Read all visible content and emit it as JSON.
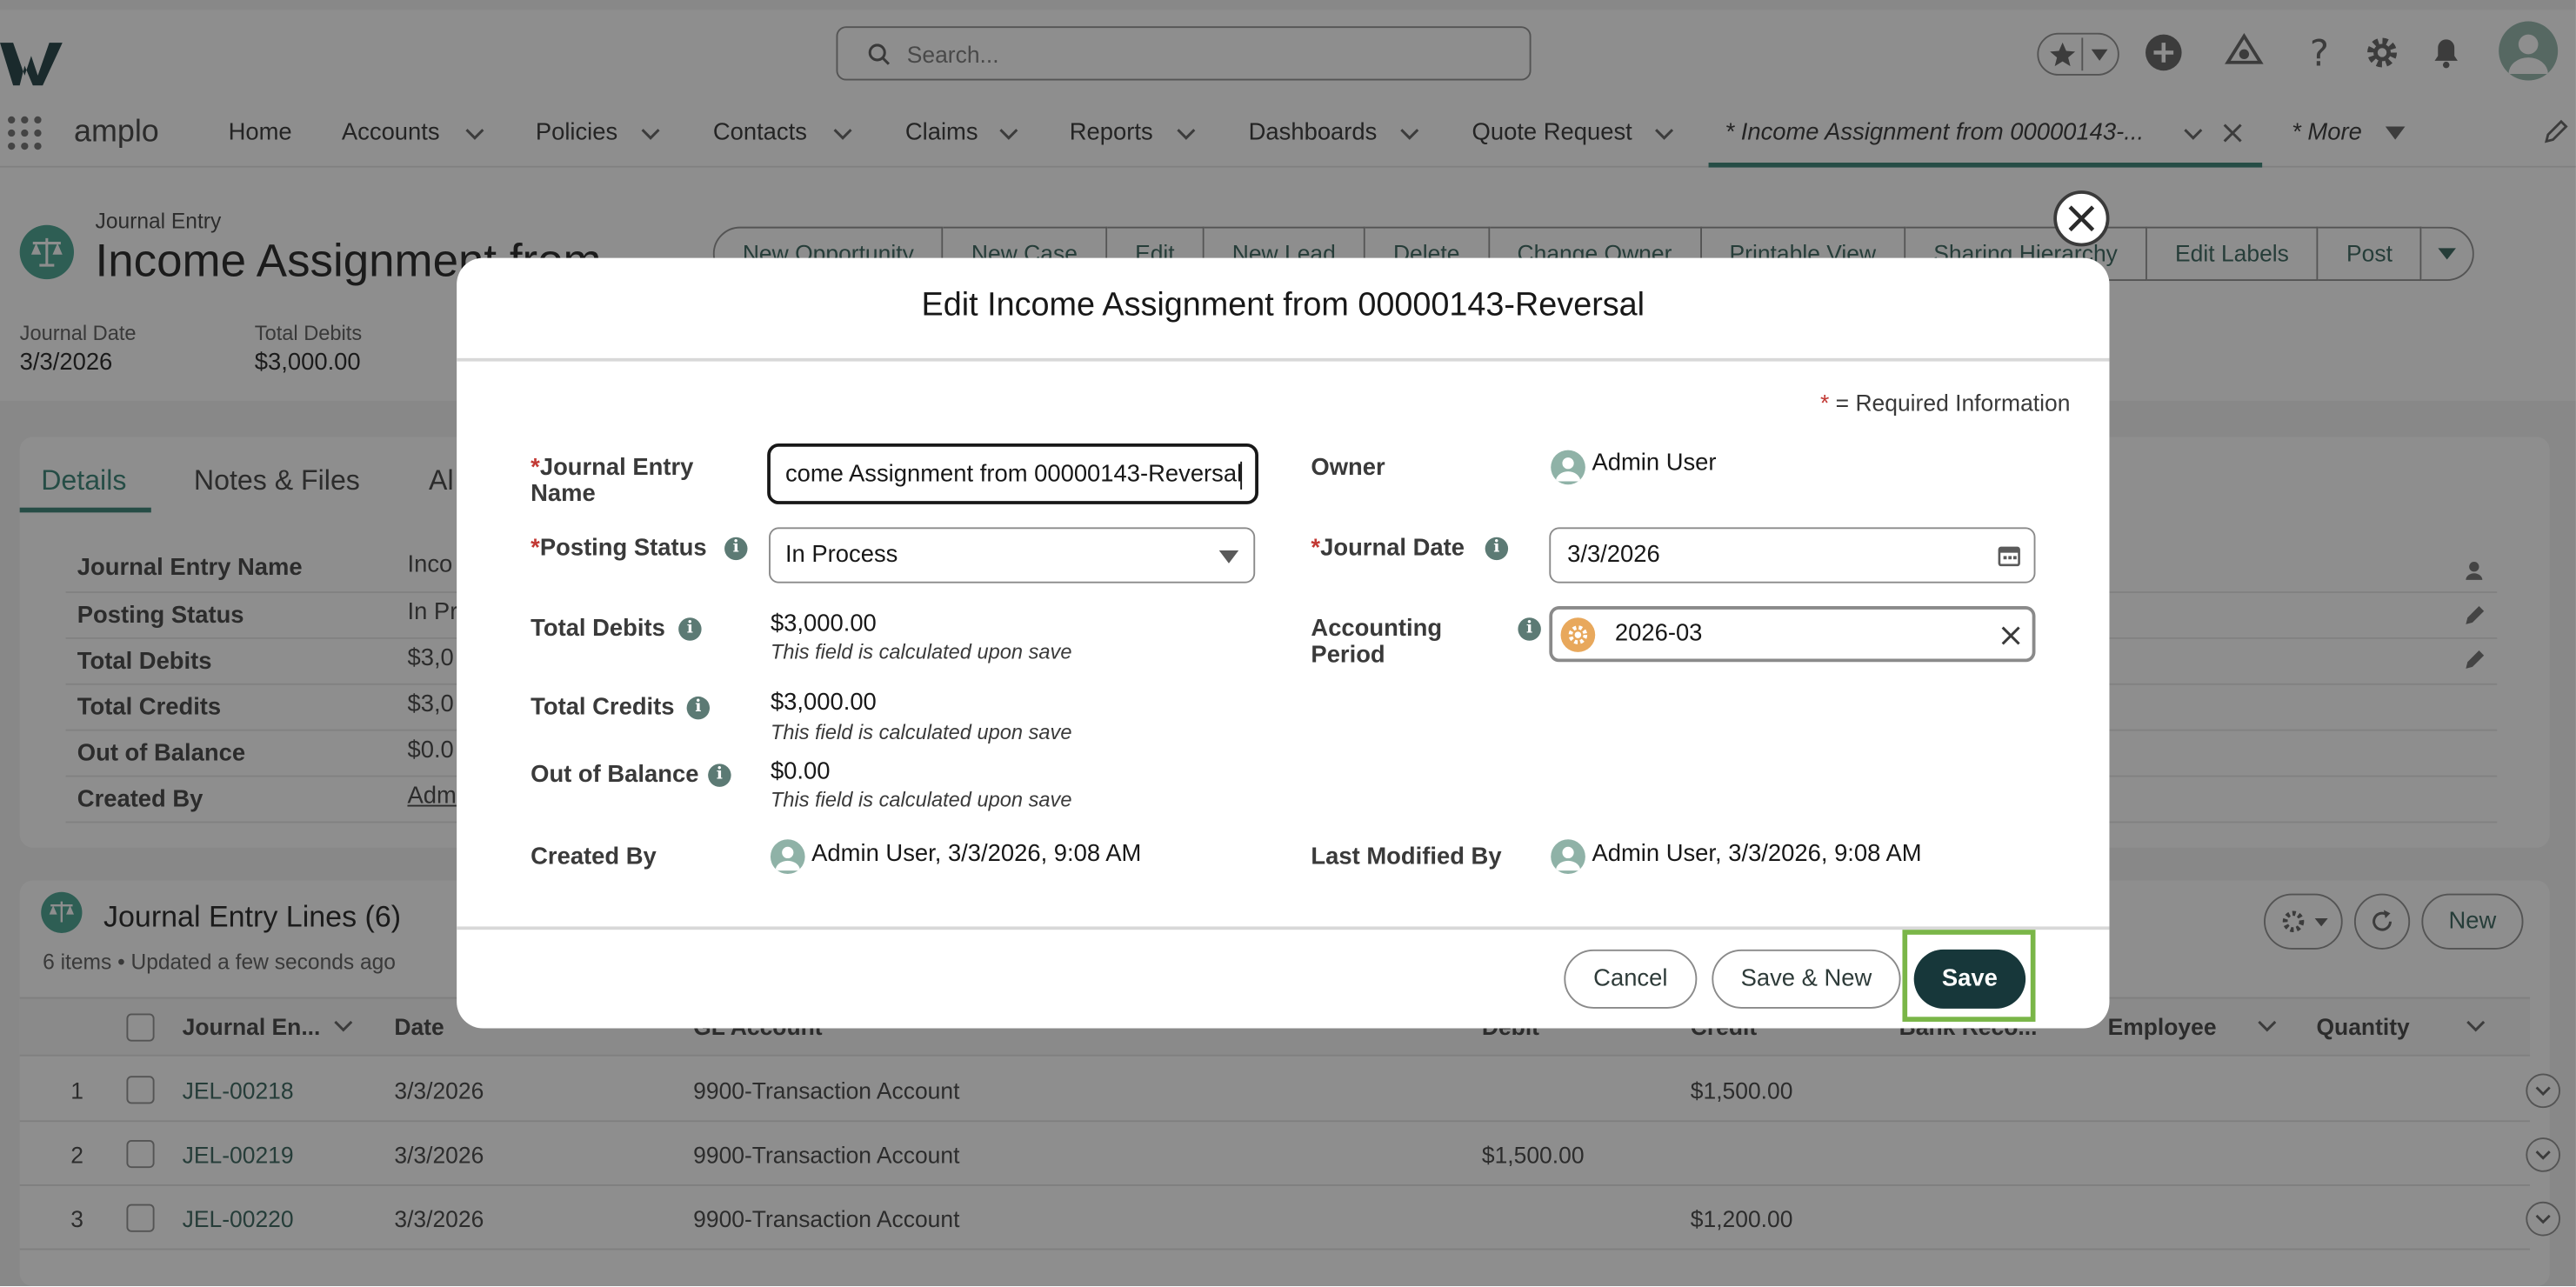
{
  "header": {
    "search_placeholder": "Search...",
    "app_name": "amplo"
  },
  "nav": {
    "items": [
      "Home",
      "Accounts",
      "Policies",
      "Contacts",
      "Claims",
      "Reports",
      "Dashboards",
      "Quote Request"
    ],
    "active_tab": "* Income Assignment from 00000143-...",
    "more": "* More"
  },
  "record": {
    "object_label": "Journal Entry",
    "title": "Income Assignment from",
    "actions": [
      "New Opportunity",
      "New Case",
      "Edit",
      "New Lead",
      "Delete",
      "Change Owner",
      "Printable View",
      "Sharing Hierarchy",
      "Edit Labels",
      "Post"
    ],
    "highlights": [
      {
        "label": "Journal Date",
        "value": "3/3/2026"
      },
      {
        "label": "Total Debits",
        "value": "$3,000.00"
      }
    ]
  },
  "detail_tabs": [
    "Details",
    "Notes & Files",
    "Al"
  ],
  "details": [
    {
      "label": "Journal Entry Name",
      "value": "Inco"
    },
    {
      "label": "Posting Status",
      "value": "In Pr"
    },
    {
      "label": "Total Debits",
      "value": "$3,0"
    },
    {
      "label": "Total Credits",
      "value": "$3,0"
    },
    {
      "label": "Out of Balance",
      "value": "$0.0"
    },
    {
      "label": "Created By",
      "value": "Adm"
    }
  ],
  "lines": {
    "title": "Journal Entry Lines (6)",
    "subtitle": "6 items • Updated a few seconds ago",
    "new_button": "New",
    "columns": [
      "Journal En...",
      "Date",
      "GL Account",
      "Debit",
      "Credit",
      "Bank Reco...",
      "Employee",
      "Quantity"
    ],
    "rows": [
      {
        "num": "1",
        "name": "JEL-00218",
        "date": "3/3/2026",
        "gl": "9900-Transaction Account",
        "debit": "",
        "credit": "$1,500.00"
      },
      {
        "num": "2",
        "name": "JEL-00219",
        "date": "3/3/2026",
        "gl": "9900-Transaction Account",
        "debit": "$1,500.00",
        "credit": ""
      },
      {
        "num": "3",
        "name": "JEL-00220",
        "date": "3/3/2026",
        "gl": "9900-Transaction Account",
        "debit": "",
        "credit": "$1,200.00"
      }
    ]
  },
  "modal": {
    "title": "Edit Income Assignment from 00000143-Reversal",
    "required_note": "= Required Information",
    "required_star": "*",
    "fields": {
      "journal_entry_name_label": "Journal Entry Name",
      "journal_entry_name_value": "come Assignment from 00000143-Reversal",
      "posting_status_label": "Posting Status",
      "posting_status_value": "In Process",
      "total_debits_label": "Total Debits",
      "total_debits_value": "$3,000.00",
      "total_credits_label": "Total Credits",
      "total_credits_value": "$3,000.00",
      "out_of_balance_label": "Out of Balance",
      "out_of_balance_value": "$0.00",
      "calc_note": "This field is calculated upon save",
      "created_by_label": "Created By",
      "created_by_value": "Admin User, 3/3/2026, 9:08 AM",
      "owner_label": "Owner",
      "owner_value": "Admin User",
      "journal_date_label": "Journal Date",
      "journal_date_value": "3/3/2026",
      "accounting_period_label": "Accounting Period",
      "accounting_period_value": "2026-03",
      "last_modified_label": "Last Modified By",
      "last_modified_value": "Admin User, 3/3/2026, 9:08 AM"
    },
    "buttons": {
      "cancel": "Cancel",
      "save_new": "Save & New",
      "save": "Save"
    }
  },
  "colors": {
    "brand": "#2e7d6f",
    "save": "#17373a",
    "highlight": "#7ab648",
    "required": "#c23934"
  }
}
